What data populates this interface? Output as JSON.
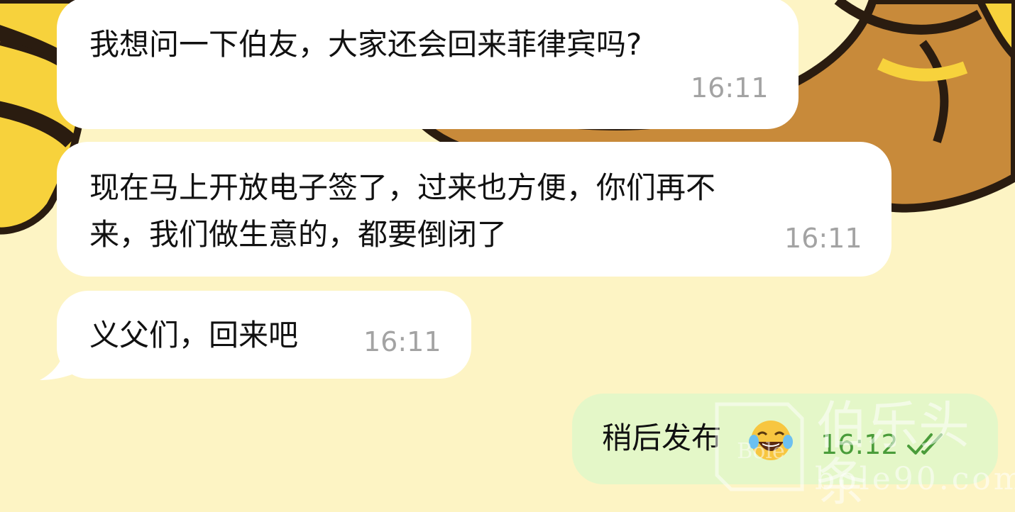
{
  "conversation": {
    "messages": [
      {
        "direction": "incoming",
        "text": "我想问一下伯友，大家还会回来菲律宾吗?",
        "time": "16:11"
      },
      {
        "direction": "incoming",
        "text_line1": "现在马上开放电子签了，过来也方便，你们再不",
        "text_line2": "来，我们做生意的，都要倒闭了",
        "time": "16:11"
      },
      {
        "direction": "incoming",
        "text": "义父们，回来吧",
        "time": "16:11"
      },
      {
        "direction": "outgoing",
        "text": "稍后发布",
        "emoji": "face-with-tears-of-joy",
        "time": "16:12",
        "status": "read-double-check"
      }
    ]
  },
  "watermark": {
    "title": "伯乐头条",
    "url": "bole90.com",
    "logo_text": "Bole"
  },
  "colors": {
    "wallpaper": "#fdf4c4",
    "incoming_bubble": "#ffffff",
    "outgoing_bubble": "#e4f7c8",
    "timestamp": "#a3a3a3",
    "outgoing_timestamp": "#4a9c3a"
  }
}
